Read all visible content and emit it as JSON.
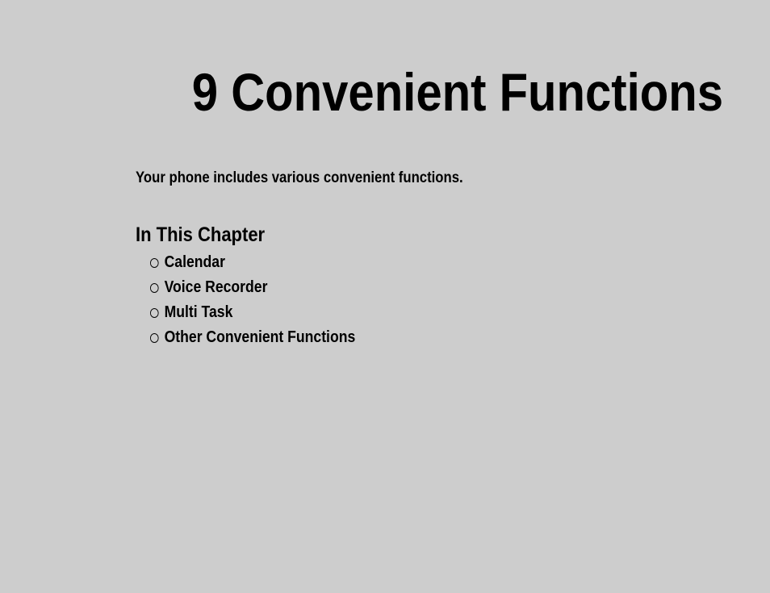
{
  "chapter": {
    "number": "9",
    "title": "Convenient Functions",
    "full_title": "9  Convenient Functions"
  },
  "intro": "Your phone includes various convenient functions.",
  "section_heading": "In This Chapter",
  "items": [
    "Calendar",
    "Voice Recorder",
    "Multi Task",
    "Other Convenient Functions"
  ]
}
